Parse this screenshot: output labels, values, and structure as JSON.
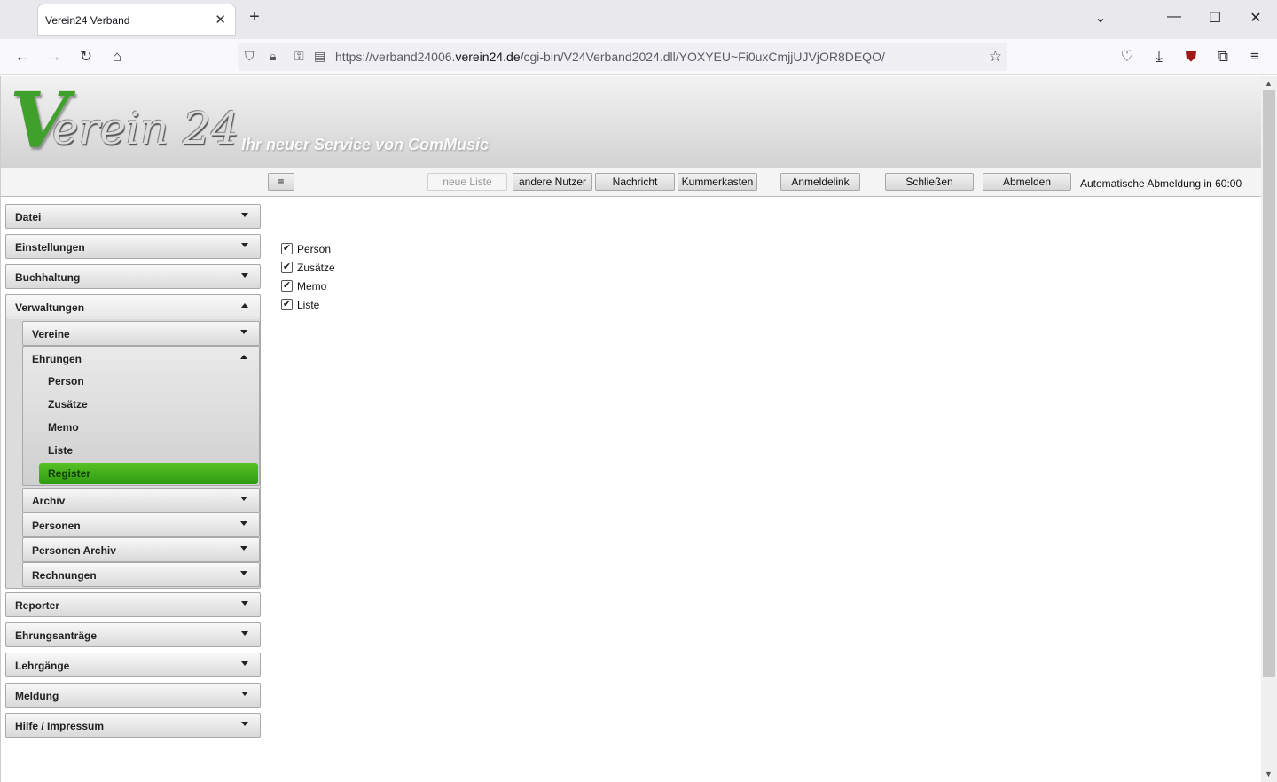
{
  "browser": {
    "tab_title": "Verein24 Verband",
    "url_prefix": "https://verband24006.",
    "url_domain": "verein24.de",
    "url_path": "/cgi-bin/V24Verband2024.dll/YOXYEU~Fi0uxCmjjUJVjOR8DEQO/"
  },
  "header": {
    "logo_v": "V",
    "logo_rest": "erein 24",
    "slogan": "Ihr neuer Service von ComMusic"
  },
  "toolbar": {
    "menu_icon": "≡",
    "new_list": "neue Liste",
    "other_users": "andere Nutzer",
    "message": "Nachricht",
    "complaints": "Kummerkasten",
    "login_link": "Anmeldelink",
    "close": "Schließen",
    "logout": "Abmelden",
    "auto_logout": "Automatische Abmeldung in 60:00"
  },
  "sidebar": {
    "top": [
      "Datei",
      "Einstellungen",
      "Buchhaltung",
      "Verwaltungen"
    ],
    "verwaltungen_sub": [
      "Vereine",
      "Ehrungen"
    ],
    "ehrungen_items": [
      "Person",
      "Zusätze",
      "Memo",
      "Liste",
      "Register"
    ],
    "verwaltungen_sub2": [
      "Archiv",
      "Personen",
      "Personen Archiv",
      "Rechnungen"
    ],
    "bottom": [
      "Reporter",
      "Ehrungsanträge",
      "Lehrgänge",
      "Meldung",
      "Hilfe / Impressum"
    ],
    "active_item": "Register",
    "active_color": "#3fae18"
  },
  "content": {
    "checkboxes": [
      {
        "label": "Person",
        "checked": true
      },
      {
        "label": "Zusätze",
        "checked": true
      },
      {
        "label": "Memo",
        "checked": true
      },
      {
        "label": "Liste",
        "checked": true
      }
    ]
  }
}
